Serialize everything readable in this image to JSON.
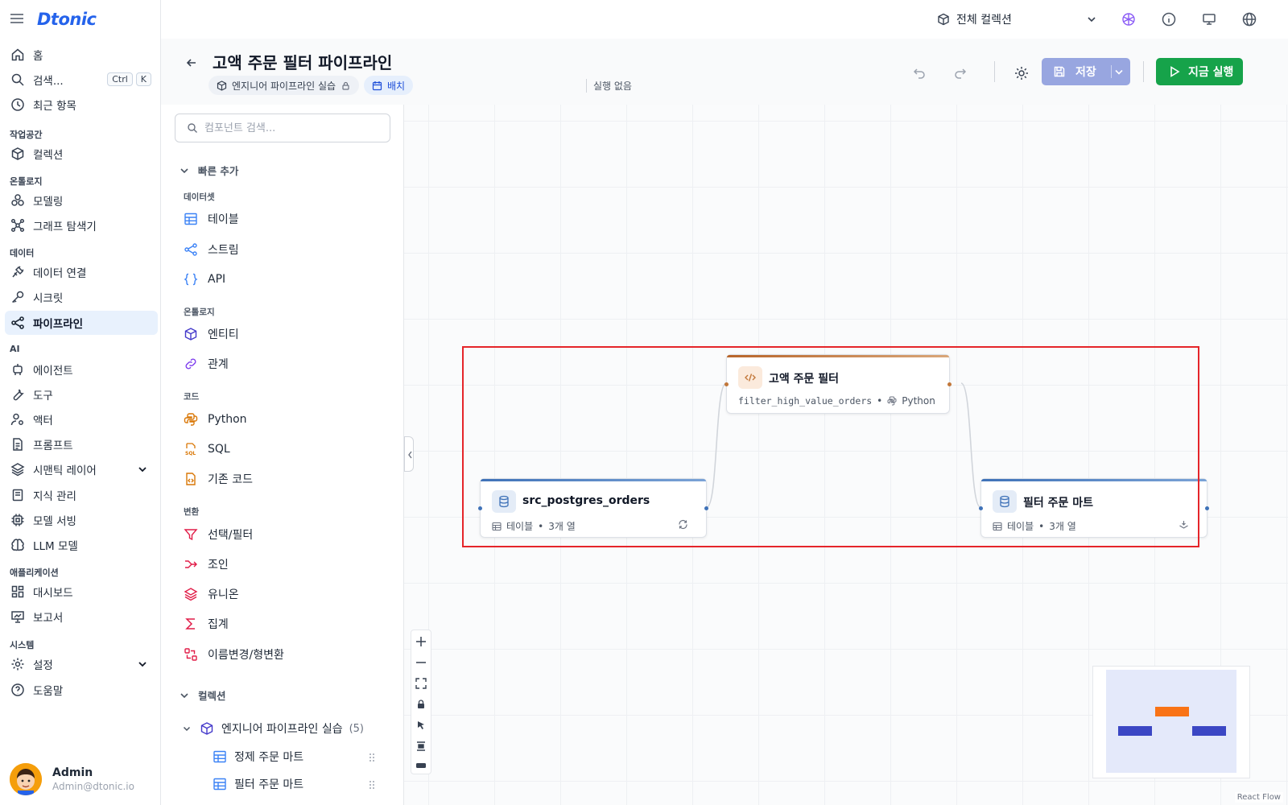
{
  "app": {
    "logo": "Dtonic"
  },
  "topbar": {
    "collection_selector": "전체 컬렉션"
  },
  "nav": {
    "home": "홈",
    "search": "검색...",
    "search_kbd": [
      "Ctrl",
      "K"
    ],
    "recent": "최근 항목",
    "sections": {
      "workspace": "작업공간",
      "ontology": "온톨로지",
      "data": "데이터",
      "ai": "AI",
      "applications": "애플리케이션",
      "system": "시스템"
    },
    "items": {
      "collection": "컬렉션",
      "modeling": "모델링",
      "graph_explorer": "그래프 탐색기",
      "data_connection": "데이터 연결",
      "secret": "시크릿",
      "pipeline": "파이프라인",
      "agent": "에이전트",
      "tool": "도구",
      "actor": "액터",
      "prompt": "프롬프트",
      "semantic_layer": "시맨틱 레이어",
      "knowledge": "지식 관리",
      "model_serving": "모델 서빙",
      "llm_model": "LLM 모델",
      "dashboard": "대시보드",
      "report": "보고서",
      "settings": "설정",
      "help": "도움말"
    },
    "user": {
      "name": "Admin",
      "email": "Admin@dtonic.io"
    }
  },
  "header": {
    "title": "고액 주문 필터 파이프라인",
    "chip_project": "엔지니어 파이프라인 실습",
    "chip_mode": "배치",
    "run_status": "실행 없음",
    "save_label": "저장",
    "run_label": "지금 실행"
  },
  "panel": {
    "search_placeholder": "컴포넌트 검색...",
    "quick_add": "빠른 추가",
    "groups": {
      "dataset": "데이터셋",
      "ontology": "온톨로지",
      "code": "코드",
      "transform": "변환"
    },
    "components": {
      "table": "테이블",
      "stream": "스트림",
      "api": "API",
      "entity": "엔티티",
      "relation": "관계",
      "python": "Python",
      "sql": "SQL",
      "existing_code": "기존 코드",
      "select_filter": "선택/필터",
      "join": "조인",
      "union": "유니온",
      "aggregate": "집계",
      "rename_cast": "이름변경/형변환"
    },
    "collection_heading": "컬렉션",
    "tree": {
      "root": "엔지니어 파이프라인 실습",
      "root_count": "(5)",
      "items": [
        "정제 주문 마트",
        "필터 주문 마트"
      ]
    }
  },
  "canvas": {
    "nodes": {
      "source": {
        "title": "src_postgres_orders",
        "kind": "테이블",
        "cols": "3개 열"
      },
      "transform": {
        "title": "고액 주문 필터",
        "func": "filter_high_value_orders",
        "lang": "Python"
      },
      "sink": {
        "title": "필터 주문 마트",
        "kind": "테이블",
        "cols": "3개 열"
      }
    },
    "attribution": "React Flow"
  },
  "colors": {
    "accent": "#2563eb",
    "run": "#16a34a",
    "save_disabled": "#98a6e0",
    "selection": "#e5252a",
    "code_node": "#c2773a",
    "data_node": "#4a7fc1"
  }
}
